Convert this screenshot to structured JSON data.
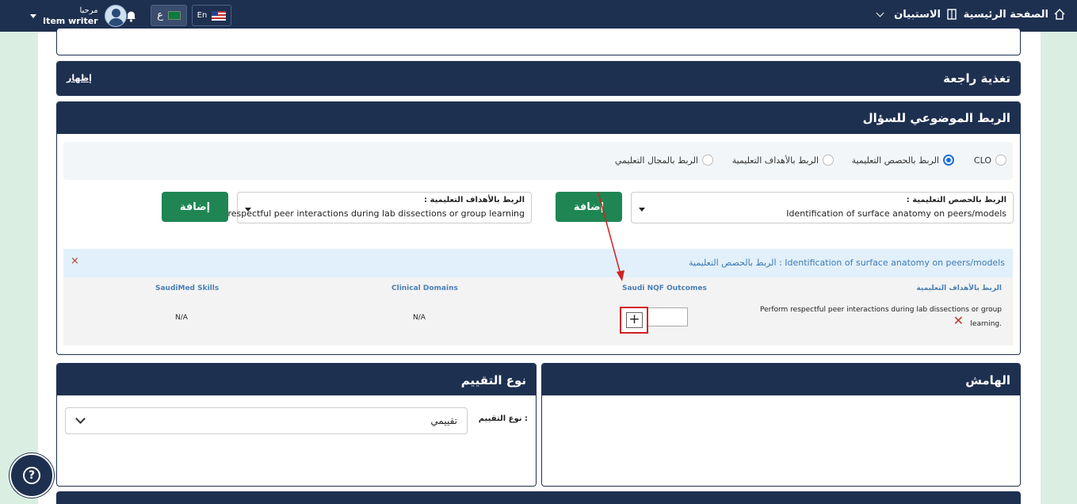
{
  "topbar": {
    "home_label": "الصفحة الرئيسية",
    "survey_label": "الاستبيان",
    "greeting": "مرحبا",
    "role": "Item writer",
    "lang_ar": "ع",
    "lang_en": "En"
  },
  "feedback": {
    "title": "تغذية راجعة",
    "show_label": "إظهار"
  },
  "linking": {
    "title": "الربط الموضوعي للسؤال",
    "radios": [
      {
        "label": "CLO",
        "selected": false
      },
      {
        "label": "الربط بالحصص التعليمية",
        "selected": true
      },
      {
        "label": "الربط بالأهداف التعليمية",
        "selected": false
      },
      {
        "label": "الربط بالمجال التعليمي",
        "selected": false
      }
    ],
    "lesson_select": {
      "label": "الربط بالحصص التعليمية :",
      "value": "Identification of surface anatomy on peers/models"
    },
    "objective_select": {
      "label": "الربط بالأهداف التعليمية :",
      "value": "... respectful peer interactions during lab dissections or group learning"
    },
    "add_label": "إضافة",
    "mapping_text": "الربط بالحصص التعليمية : Identification of surface anatomy on peers/models",
    "close_icon": "×",
    "columns": [
      "الربط بالأهداف التعليمية",
      "Saudi NQF Outcomes",
      "Clinical Domains",
      "SaudiMed Skills"
    ],
    "row": {
      "objective_line1": "Perform respectful peer interactions during lab dissections or group",
      "objective_line2": "learning.",
      "clinical": "N/A",
      "skills": "N/A",
      "plus": "+",
      "delete_icon": "✕"
    }
  },
  "margin_panel": {
    "title": "الهامش"
  },
  "evaluation": {
    "title": "نوع التقييم",
    "label": "نوع التقييم :",
    "value": "تقييمي"
  },
  "help": {
    "icon": "?"
  },
  "colors": {
    "navy": "#1e3050",
    "green": "#1f8653",
    "highlight": "#d42020"
  }
}
